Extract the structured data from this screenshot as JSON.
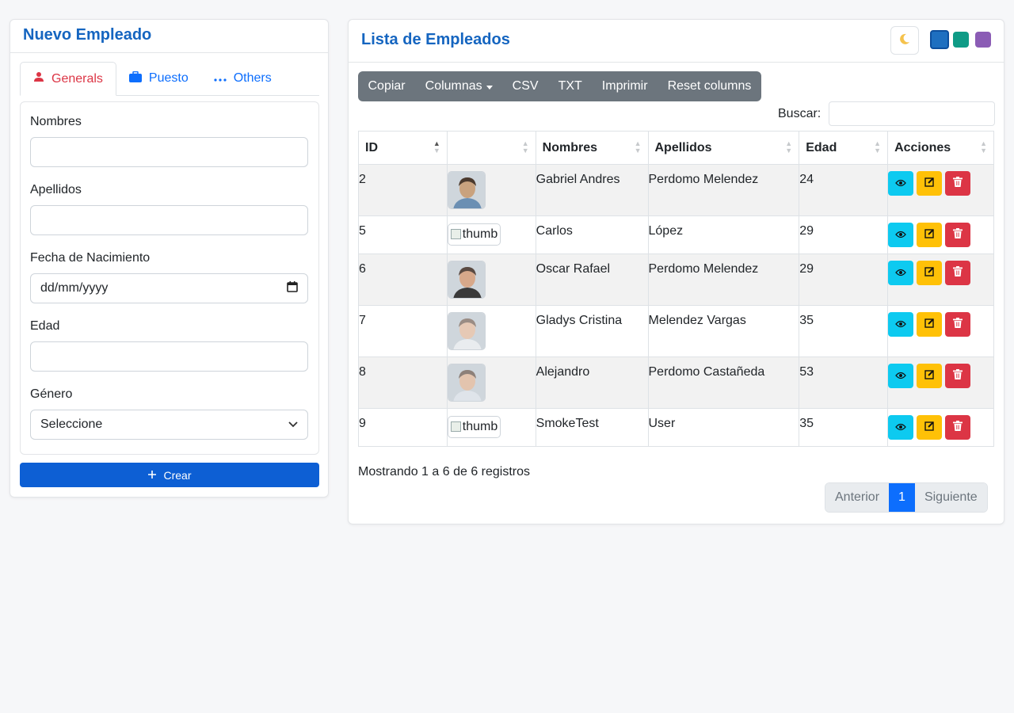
{
  "left": {
    "title": "Nuevo Empleado",
    "tabs": [
      {
        "label": "Generals",
        "icon": "user-icon"
      },
      {
        "label": "Puesto",
        "icon": "briefcase-icon"
      },
      {
        "label": "Others",
        "icon": "dots-icon"
      }
    ],
    "fields": {
      "nombres": {
        "label": "Nombres",
        "value": ""
      },
      "apellidos": {
        "label": "Apellidos",
        "value": ""
      },
      "fecha": {
        "label": "Fecha de Nacimiento",
        "placeholder": "dd/mm/yyyy"
      },
      "edad": {
        "label": "Edad",
        "value": ""
      },
      "genero": {
        "label": "Género",
        "selected": "Seleccione"
      }
    },
    "create_button": "Crear"
  },
  "right": {
    "title": "Lista de Empleados",
    "theme_swatches": [
      "#1e6fc0",
      "#0f9b86",
      "#8b5cb5"
    ],
    "toolbar": [
      "Copiar",
      "Columnas",
      "CSV",
      "TXT",
      "Imprimir",
      "Reset columns"
    ],
    "search_label": "Buscar:",
    "search_value": "",
    "columns": [
      "ID",
      "",
      "Nombres",
      "Apellidos",
      "Edad",
      "Acciones"
    ],
    "rows": [
      {
        "id": "2",
        "photo": "photo",
        "nombres": "Gabriel Andres",
        "apellidos": "Perdomo Melendez",
        "edad": "24"
      },
      {
        "id": "5",
        "photo": "thumb",
        "nombres": "Carlos",
        "apellidos": "López",
        "edad": "29"
      },
      {
        "id": "6",
        "photo": "photo",
        "nombres": "Oscar Rafael",
        "apellidos": "Perdomo Melendez",
        "edad": "29"
      },
      {
        "id": "7",
        "photo": "photo",
        "nombres": "Gladys Cristina",
        "apellidos": "Melendez Vargas",
        "edad": "35"
      },
      {
        "id": "8",
        "photo": "photo",
        "nombres": "Alejandro",
        "apellidos": "Perdomo Castañeda",
        "edad": "53"
      },
      {
        "id": "9",
        "photo": "thumb",
        "nombres": "SmokeTest",
        "apellidos": "User",
        "edad": "35"
      }
    ],
    "info": "Mostrando 1 a 6 de 6 registros",
    "pager": {
      "prev": "Anterior",
      "current": "1",
      "next": "Siguiente"
    }
  }
}
